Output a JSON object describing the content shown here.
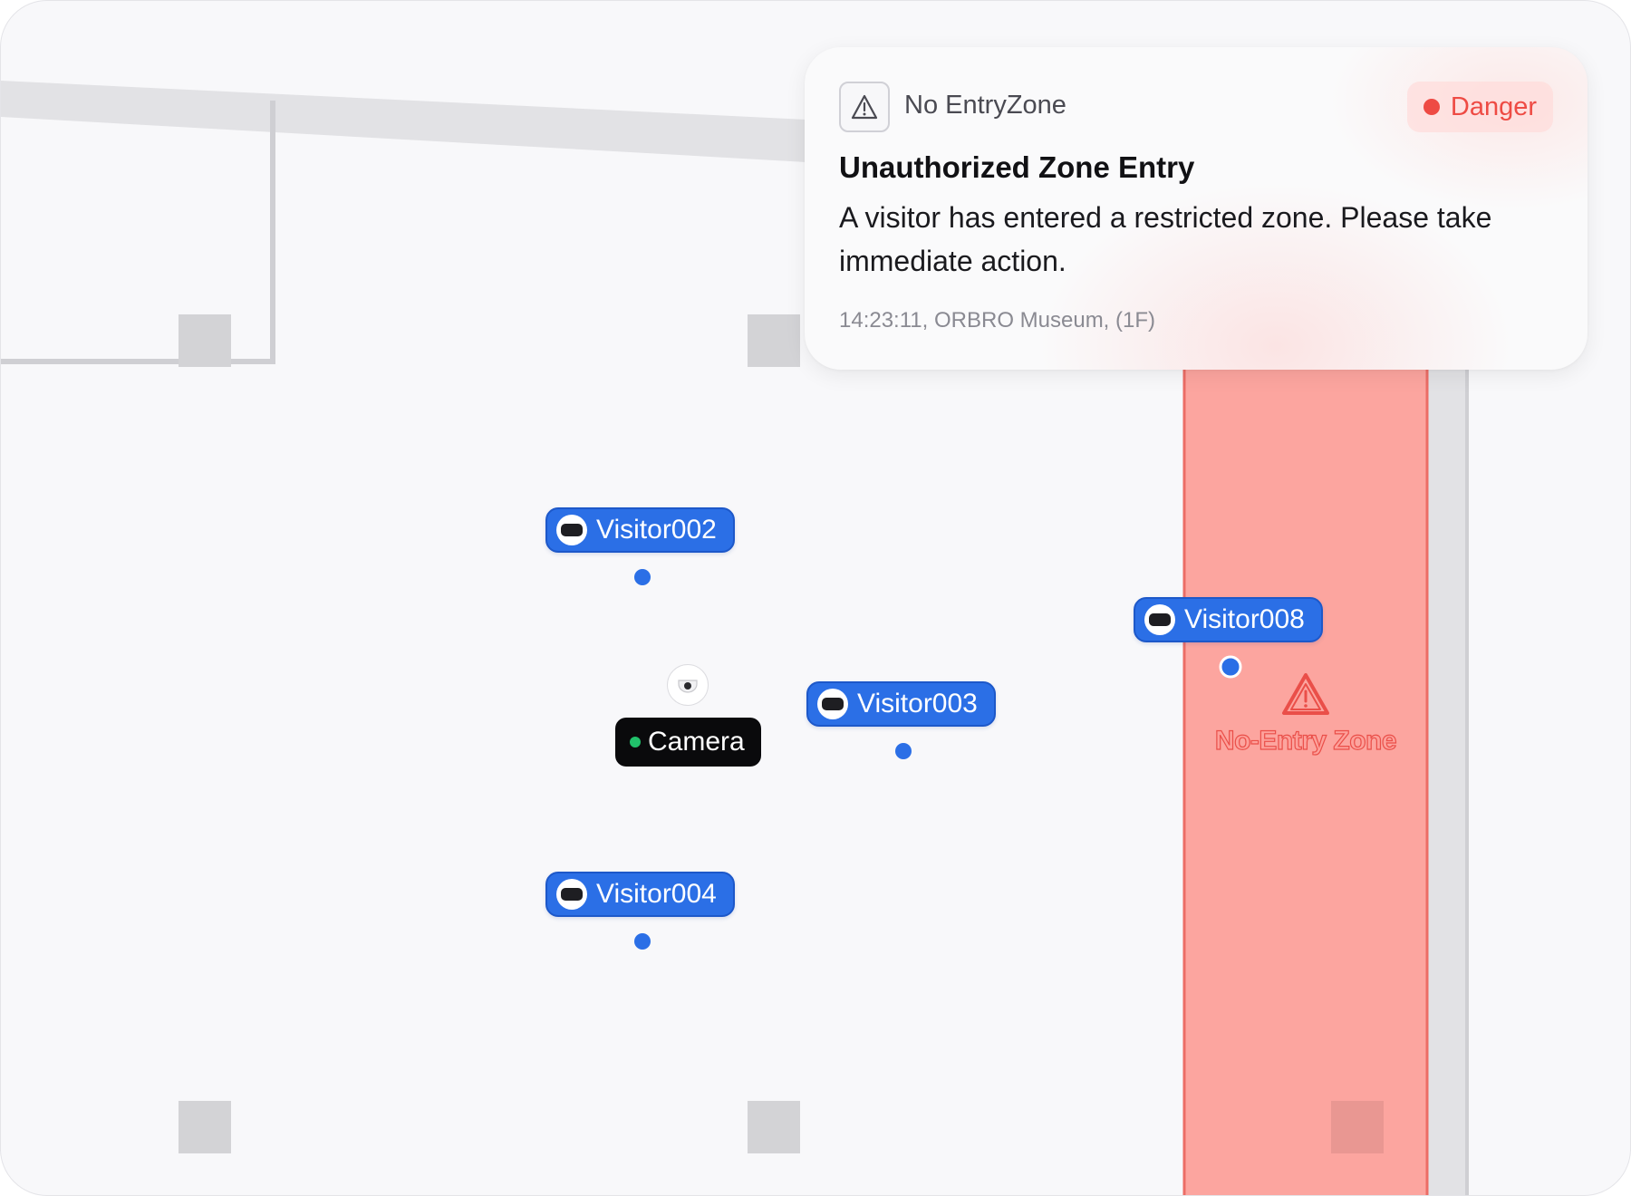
{
  "alert": {
    "category": "No EntryZone",
    "category_icon": "warning-triangle-icon",
    "severity": "Danger",
    "severity_color": "#ee4b44",
    "title": "Unauthorized Zone Entry",
    "message": "A visitor has entered a restricted zone. Please take immediate action.",
    "meta": "14:23:11, ORBRO Museum, (1F)"
  },
  "map": {
    "camera": {
      "label": "Camera",
      "status_color": "#21c16b",
      "icon": "dome-camera-icon"
    },
    "visitors": [
      {
        "name": "Visitor002",
        "icon": "tag-device-icon"
      },
      {
        "name": "Visitor003",
        "icon": "tag-device-icon"
      },
      {
        "name": "Visitor004",
        "icon": "tag-device-icon"
      },
      {
        "name": "Visitor008",
        "icon": "tag-device-icon"
      }
    ],
    "zone": {
      "label": "No-Entry Zone",
      "icon": "warning-triangle-icon",
      "fill_color": "#fca59f",
      "border_color": "#ec6d66"
    },
    "visitor_color": "#2b6fe6"
  }
}
